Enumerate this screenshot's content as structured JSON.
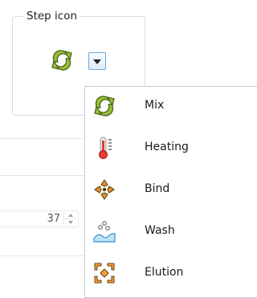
{
  "group": {
    "label": "Step icon",
    "current_icon": "mix-icon"
  },
  "stepper": {
    "value": "37"
  },
  "menu": {
    "items": [
      {
        "label": "Mix",
        "icon": "mix-icon"
      },
      {
        "label": "Heating",
        "icon": "heating-icon"
      },
      {
        "label": "Bind",
        "icon": "bind-icon"
      },
      {
        "label": "Wash",
        "icon": "wash-icon"
      },
      {
        "label": "Elution",
        "icon": "elution-icon"
      }
    ]
  },
  "colors": {
    "mix_green": "#9bbf3a",
    "mix_outline": "#4d6a1c",
    "heat_red": "#e53a2e",
    "bind_orange": "#e0932e",
    "wash_blue": "#4aa3df",
    "elution_orange": "#f0a33a",
    "dropdown_border": "#6aa6d8"
  }
}
